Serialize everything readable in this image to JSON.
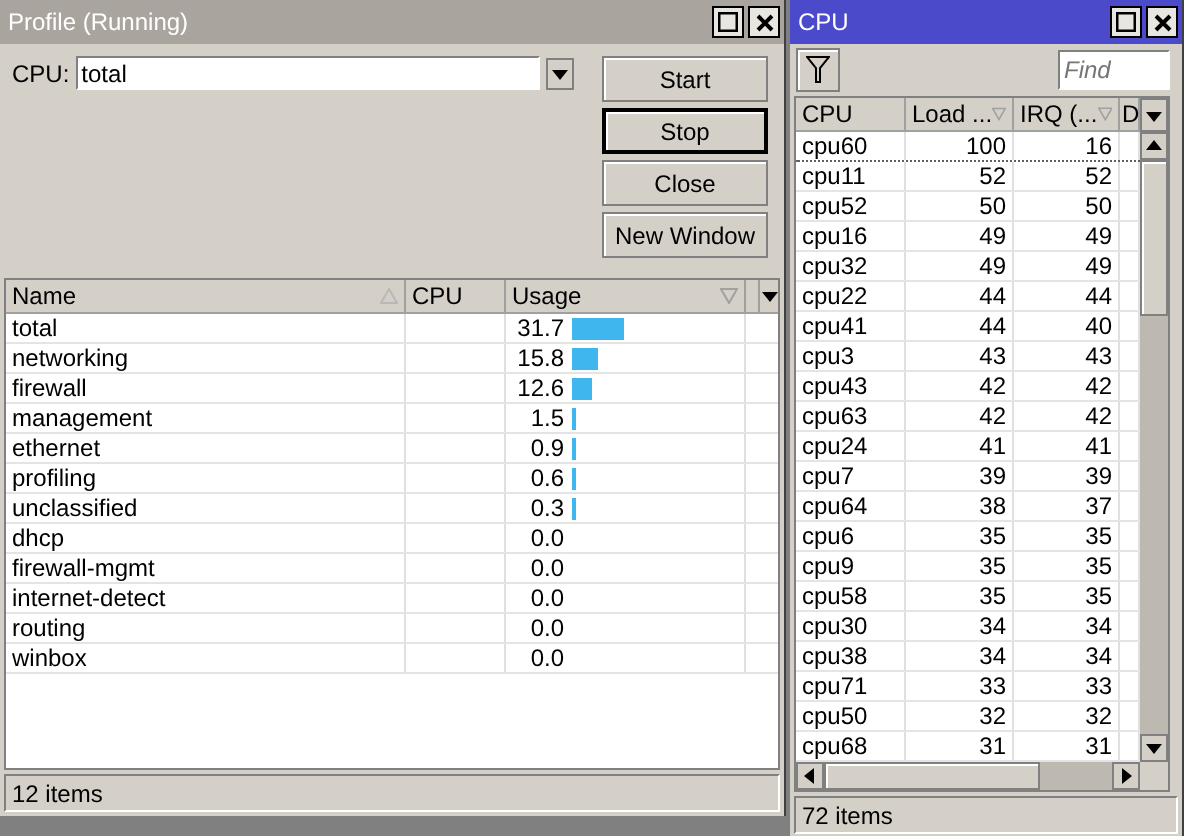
{
  "profile_window": {
    "title": "Profile (Running)",
    "active": false,
    "cpu_label": "CPU:",
    "cpu_value": "total",
    "buttons": [
      {
        "label": "Start",
        "focused": false
      },
      {
        "label": "Stop",
        "focused": true
      },
      {
        "label": "Close",
        "focused": false
      },
      {
        "label": "New Window",
        "focused": false
      }
    ],
    "table": {
      "columns": [
        "Name",
        "CPU",
        "Usage"
      ],
      "rows": [
        {
          "name": "total",
          "usage": "31.7"
        },
        {
          "name": "networking",
          "usage": "15.8"
        },
        {
          "name": "firewall",
          "usage": "12.6"
        },
        {
          "name": "management",
          "usage": "1.5"
        },
        {
          "name": "ethernet",
          "usage": "0.9"
        },
        {
          "name": "profiling",
          "usage": "0.6"
        },
        {
          "name": "unclassified",
          "usage": "0.3"
        },
        {
          "name": "dhcp",
          "usage": "0.0"
        },
        {
          "name": "firewall-mgmt",
          "usage": "0.0"
        },
        {
          "name": "internet-detect",
          "usage": "0.0"
        },
        {
          "name": "routing",
          "usage": "0.0"
        },
        {
          "name": "winbox",
          "usage": "0.0"
        }
      ]
    },
    "status_bar": "12 items"
  },
  "cpu_window": {
    "title": "CPU",
    "active": true,
    "find_placeholder": "Find",
    "table": {
      "columns": [
        "CPU",
        "Load ...",
        "IRQ (...",
        "D"
      ],
      "rows": [
        {
          "cpu": "cpu60",
          "load": "100",
          "irq": "16",
          "selected": true
        },
        {
          "cpu": "cpu11",
          "load": "52",
          "irq": "52",
          "selected": false
        },
        {
          "cpu": "cpu52",
          "load": "50",
          "irq": "50",
          "selected": false
        },
        {
          "cpu": "cpu16",
          "load": "49",
          "irq": "49",
          "selected": false
        },
        {
          "cpu": "cpu32",
          "load": "49",
          "irq": "49",
          "selected": false
        },
        {
          "cpu": "cpu22",
          "load": "44",
          "irq": "44",
          "selected": false
        },
        {
          "cpu": "cpu41",
          "load": "44",
          "irq": "40",
          "selected": false
        },
        {
          "cpu": "cpu3",
          "load": "43",
          "irq": "43",
          "selected": false
        },
        {
          "cpu": "cpu43",
          "load": "42",
          "irq": "42",
          "selected": false
        },
        {
          "cpu": "cpu63",
          "load": "42",
          "irq": "42",
          "selected": false
        },
        {
          "cpu": "cpu24",
          "load": "41",
          "irq": "41",
          "selected": false
        },
        {
          "cpu": "cpu7",
          "load": "39",
          "irq": "39",
          "selected": false
        },
        {
          "cpu": "cpu64",
          "load": "38",
          "irq": "37",
          "selected": false
        },
        {
          "cpu": "cpu6",
          "load": "35",
          "irq": "35",
          "selected": false
        },
        {
          "cpu": "cpu9",
          "load": "35",
          "irq": "35",
          "selected": false
        },
        {
          "cpu": "cpu58",
          "load": "35",
          "irq": "35",
          "selected": false
        },
        {
          "cpu": "cpu30",
          "load": "34",
          "irq": "34",
          "selected": false
        },
        {
          "cpu": "cpu38",
          "load": "34",
          "irq": "34",
          "selected": false
        },
        {
          "cpu": "cpu71",
          "load": "33",
          "irq": "33",
          "selected": false
        },
        {
          "cpu": "cpu50",
          "load": "32",
          "irq": "32",
          "selected": false
        },
        {
          "cpu": "cpu68",
          "load": "31",
          "irq": "31",
          "selected": false
        }
      ]
    },
    "status_bar": "72 items"
  }
}
